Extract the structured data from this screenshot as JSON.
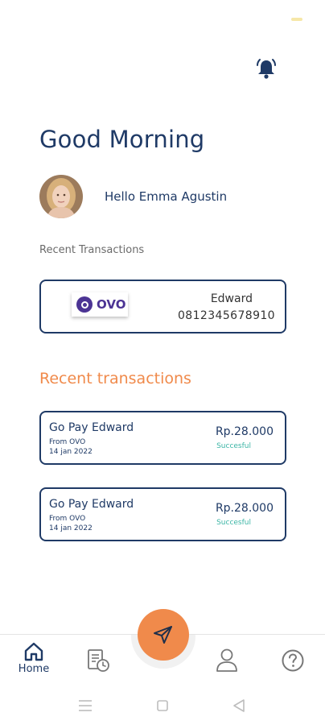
{
  "header": {
    "greeting": "Good Morning",
    "hello_text": "Hello Emma Agustin",
    "notification_icon": "bell-icon"
  },
  "recent_wallet": {
    "label": "Recent Transactions",
    "provider": "OVO",
    "name": "Edward",
    "phone": "0812345678910"
  },
  "transactions": {
    "title": "Recent transactions",
    "items": [
      {
        "title": "Go Pay Edward",
        "from": "From OVO",
        "date": "14 jan 2022",
        "amount": "Rp.28.000",
        "status": "Succesful"
      },
      {
        "title": "Go Pay Edward",
        "from": "From OVO",
        "date": "14 jan 2022",
        "amount": "Rp.28.000",
        "status": "Succesful"
      }
    ]
  },
  "bottom_nav": {
    "home_label": "Home",
    "items": [
      "home-icon",
      "receipt-clock-icon",
      "send-icon",
      "user-icon",
      "help-icon"
    ]
  },
  "colors": {
    "primary": "#1f3a66",
    "accent": "#f08a4b",
    "success": "#3bb5a5",
    "ovo": "#4c3494"
  }
}
